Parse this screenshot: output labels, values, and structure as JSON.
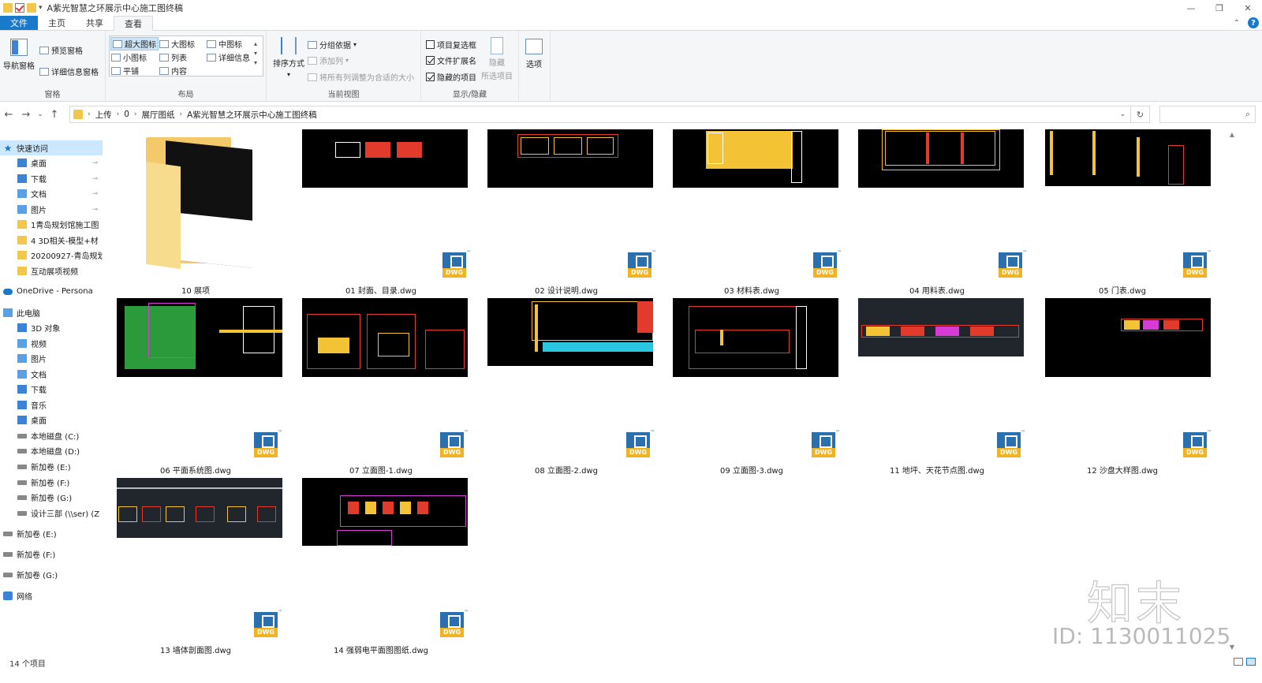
{
  "window": {
    "title": "A紫光智慧之环展示中心施工图终稿"
  },
  "tabs": [
    {
      "label": "文件"
    },
    {
      "label": "主页"
    },
    {
      "label": "共享"
    },
    {
      "label": "查看"
    }
  ],
  "ribbon": {
    "panes": {
      "label": "窗格",
      "nav_pane": "导航窗格",
      "preview_pane": "预览窗格",
      "details_pane": "详细信息窗格"
    },
    "layout": {
      "label": "布局",
      "items": [
        "超大图标",
        "大图标",
        "中图标",
        "小图标",
        "列表",
        "详细信息",
        "平铺",
        "内容"
      ],
      "selected": "超大图标"
    },
    "current_view": {
      "label": "当前视图",
      "sort_by": "排序方式",
      "group_by": "分组依据",
      "add_column": "添加列",
      "fit_columns": "将所有列调整为合适的大小"
    },
    "show_hide": {
      "label": "显示/隐藏",
      "item_checkboxes": "项目复选框",
      "file_extensions": "文件扩展名",
      "hidden_items": "隐藏的项目",
      "hide_selected_line1": "隐藏",
      "hide_selected_line2": "所选项目",
      "item_checkboxes_checked": false,
      "file_extensions_checked": true,
      "hidden_items_checked": true
    },
    "options": {
      "label": "选项"
    }
  },
  "address": {
    "crumbs": [
      "上传",
      "0",
      "展厅图纸",
      "A紫光智慧之环展示中心施工图终稿"
    ]
  },
  "sidebar": {
    "items": [
      {
        "label": "快速访问",
        "icon": "star-icon"
      },
      {
        "label": "桌面",
        "icon": "desktop-icon"
      },
      {
        "label": "下载",
        "icon": "download-icon"
      },
      {
        "label": "文档",
        "icon": "documents-icon"
      },
      {
        "label": "图片",
        "icon": "pictures-icon"
      },
      {
        "label": "1青岛规划馆施工图",
        "icon": "folder-icon"
      },
      {
        "label": "4 3D相关-模型+材",
        "icon": "folder-icon"
      },
      {
        "label": "20200927-青岛规划",
        "icon": "folder-icon"
      },
      {
        "label": "互动展项视频",
        "icon": "folder-icon"
      },
      {
        "label": "OneDrive - Persona",
        "icon": "cloud-icon"
      },
      {
        "label": "此电脑",
        "icon": "pc-icon"
      },
      {
        "label": "3D 对象",
        "icon": "3d-objects-icon"
      },
      {
        "label": "视频",
        "icon": "videos-icon"
      },
      {
        "label": "图片",
        "icon": "pictures-icon"
      },
      {
        "label": "文档",
        "icon": "documents-icon"
      },
      {
        "label": "下载",
        "icon": "download-icon"
      },
      {
        "label": "音乐",
        "icon": "music-icon"
      },
      {
        "label": "桌面",
        "icon": "desktop-icon"
      },
      {
        "label": "本地磁盘 (C:)",
        "icon": "drive-icon"
      },
      {
        "label": "本地磁盘 (D:)",
        "icon": "drive-icon"
      },
      {
        "label": "新加卷 (E:)",
        "icon": "drive-icon"
      },
      {
        "label": "新加卷 (F:)",
        "icon": "drive-icon"
      },
      {
        "label": "新加卷 (G:)",
        "icon": "drive-icon"
      },
      {
        "label": "设计三部 (\\\\ser) (Z",
        "icon": "network-drive-icon"
      },
      {
        "label": "新加卷 (E:)",
        "icon": "drive-icon"
      },
      {
        "label": "新加卷 (F:)",
        "icon": "drive-icon"
      },
      {
        "label": "新加卷 (G:)",
        "icon": "drive-icon"
      },
      {
        "label": "网络",
        "icon": "network-icon"
      }
    ]
  },
  "files": [
    {
      "name": "10 展项",
      "type": "folder"
    },
    {
      "name": "01 封面、目录.dwg",
      "type": "dwg"
    },
    {
      "name": "02 设计说明.dwg",
      "type": "dwg"
    },
    {
      "name": "03 材料表.dwg",
      "type": "dwg"
    },
    {
      "name": "04 用料表.dwg",
      "type": "dwg"
    },
    {
      "name": "05 门表.dwg",
      "type": "dwg"
    },
    {
      "name": "06 平面系统图.dwg",
      "type": "dwg"
    },
    {
      "name": "07 立面图-1.dwg",
      "type": "dwg"
    },
    {
      "name": "08 立面图-2.dwg",
      "type": "dwg"
    },
    {
      "name": "09 立面图-3.dwg",
      "type": "dwg"
    },
    {
      "name": "11 地坪、天花节点图.dwg",
      "type": "dwg"
    },
    {
      "name": "12 沙盘大样图.dwg",
      "type": "dwg"
    },
    {
      "name": "13 墙体剖面图.dwg",
      "type": "dwg"
    },
    {
      "name": "14 强弱电平面图图纸.dwg",
      "type": "dwg"
    }
  ],
  "dwg_badge": "DWG",
  "status": {
    "count": "14 个项目"
  },
  "watermark": {
    "logo": "知末",
    "id": "ID: 1130011025"
  },
  "colors": {
    "accent": "#1979ca",
    "selection": "#cce8ff",
    "cad_black": "#000000",
    "dwg_blue": "#2a6fae",
    "dwg_yellow": "#f0b323"
  }
}
